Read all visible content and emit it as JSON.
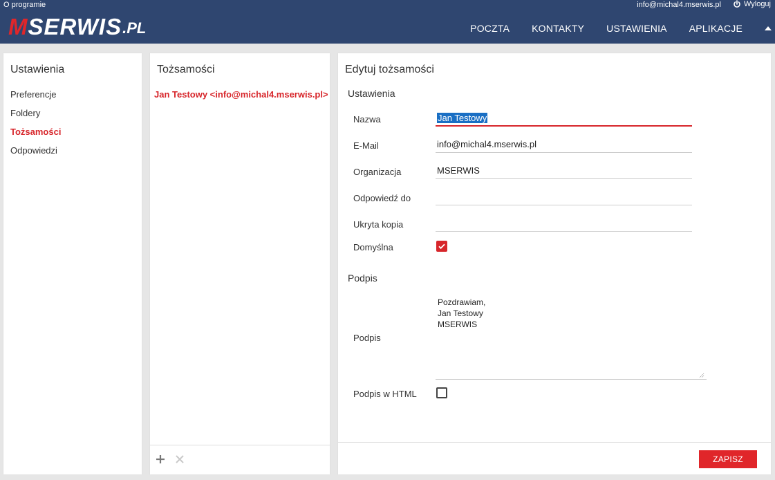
{
  "topbar": {
    "about": "O programie",
    "user_email": "info@michal4.mserwis.pl",
    "logout": "Wyloguj",
    "logo": {
      "m": "M",
      "rest": "SERWIS",
      "suffix": ".PL"
    },
    "nav": [
      "POCZTA",
      "KONTAKTY",
      "USTAWIENIA",
      "APLIKACJE"
    ],
    "colors": {
      "bar": "#2f4670",
      "accent": "#e0262a"
    }
  },
  "settings": {
    "title": "Ustawienia",
    "items": [
      "Preferencje",
      "Foldery",
      "Tożsamości",
      "Odpowiedzi"
    ],
    "active": "Tożsamości"
  },
  "identities": {
    "title": "Tożsamości",
    "items": [
      "Jan Testowy <info@michal4.mserwis.pl>"
    ]
  },
  "edit": {
    "title": "Edytuj tożsamości",
    "section_settings": "Ustawienia",
    "fields": {
      "name": {
        "label": "Nazwa",
        "value": "Jan Testowy"
      },
      "email": {
        "label": "E-Mail",
        "value": "info@michal4.mserwis.pl"
      },
      "organization": {
        "label": "Organizacja",
        "value": "MSERWIS"
      },
      "reply_to": {
        "label": "Odpowiedź do",
        "value": ""
      },
      "bcc": {
        "label": "Ukryta kopia",
        "value": ""
      },
      "default": {
        "label": "Domyślna",
        "checked": true
      }
    },
    "section_signature": "Podpis",
    "signature": {
      "label": "Podpis",
      "value": "Pozdrawiam,\nJan Testowy\nMSERWIS"
    },
    "html_signature": {
      "label": "Podpis w HTML",
      "checked": false
    },
    "save": "ZAPISZ"
  }
}
